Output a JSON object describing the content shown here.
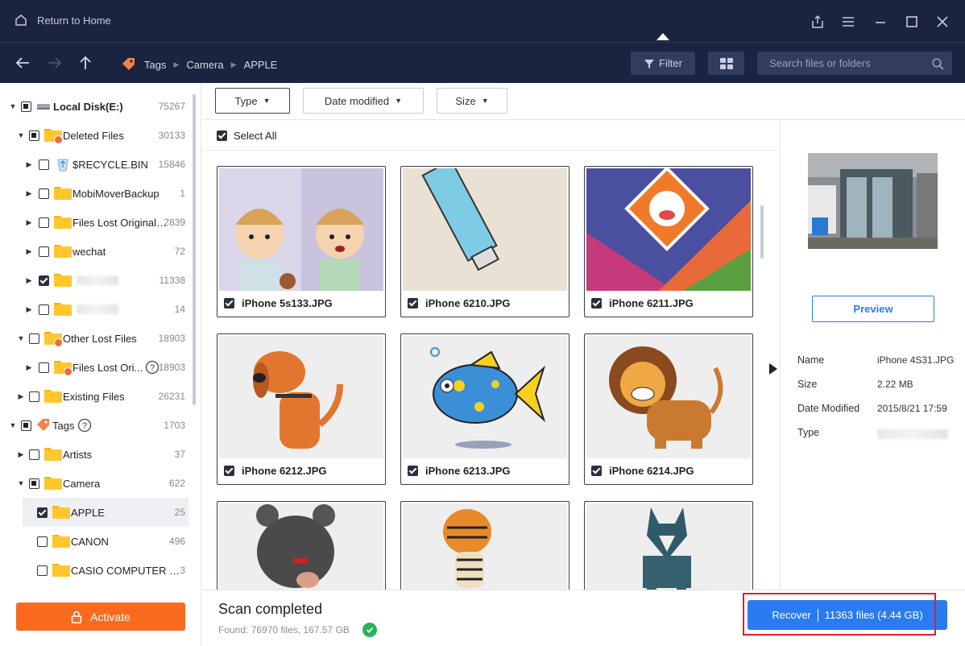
{
  "titlebar": {
    "home_label": "Return to Home"
  },
  "breadcrumb": [
    "Tags",
    "Camera",
    "APPLE"
  ],
  "toolbar": {
    "filter_label": "Filter",
    "search_placeholder": "Search files or folders"
  },
  "tree": {
    "local_disk": {
      "label": "Local Disk(E:)",
      "count": "75267"
    },
    "deleted_files": {
      "label": "Deleted Files",
      "count": "30133"
    },
    "recycle_bin": {
      "label": "$RECYCLE.BIN",
      "count": "15846"
    },
    "mobimover": {
      "label": "MobiMoverBackup",
      "count": "1"
    },
    "files_lost_original": {
      "label": "Files Lost Original ...",
      "count": "2839"
    },
    "wechat": {
      "label": "wechat",
      "count": "72"
    },
    "hidden_1": {
      "count": "11338"
    },
    "hidden_2": {
      "count": "14"
    },
    "other_lost": {
      "label": "Other Lost Files",
      "count": "18903"
    },
    "files_lost_ori": {
      "label": "Files Lost Ori...",
      "count": "18903"
    },
    "existing_files": {
      "label": "Existing Files",
      "count": "26231"
    },
    "tags": {
      "label": "Tags",
      "count": "1703"
    },
    "artists": {
      "label": "Artists",
      "count": "37"
    },
    "camera": {
      "label": "Camera",
      "count": "622"
    },
    "apple": {
      "label": "APPLE",
      "count": "25"
    },
    "canon": {
      "label": "CANON",
      "count": "496"
    },
    "casio": {
      "label": "CASIO COMPUTER CO...",
      "count": "3"
    }
  },
  "activate_label": "Activate",
  "filters": {
    "type": "Type",
    "date": "Date modified",
    "size": "Size"
  },
  "select_all": "Select All",
  "files": [
    {
      "name": "iPhone 5s133.JPG"
    },
    {
      "name": "iPhone 6210.JPG"
    },
    {
      "name": "iPhone 6211.JPG"
    },
    {
      "name": "iPhone 6212.JPG"
    },
    {
      "name": "iPhone 6213.JPG"
    },
    {
      "name": "iPhone 6214.JPG"
    }
  ],
  "status": {
    "title": "Scan completed",
    "found": "Found: 76970 files, 167.57 GB"
  },
  "recover": {
    "label": "Recover",
    "summary": "11363 files (4.44 GB)"
  },
  "preview": {
    "button": "Preview",
    "name_label": "Name",
    "name_value": "iPhone 4S31.JPG",
    "size_label": "Size",
    "size_value": "2.22 MB",
    "date_label": "Date Modified",
    "date_value": "2015/8/21 17:59",
    "type_label": "Type"
  },
  "colors": {
    "topbar": "#1a2340",
    "accent": "#2a7bf0",
    "activate": "#fa6a1e",
    "highlight": "#e0202a"
  }
}
